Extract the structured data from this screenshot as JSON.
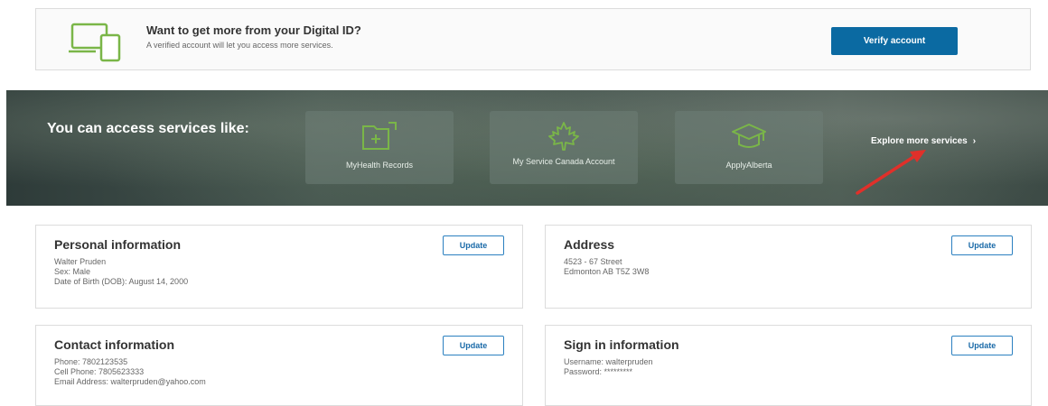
{
  "verify_banner": {
    "title": "Want to get more from your Digital ID?",
    "subtitle": "A verified account will let you access more services.",
    "button_label": "Verify account",
    "icon": "devices-icon",
    "accent_color": "#7ab648",
    "button_color": "#0b6aa2"
  },
  "services": {
    "title": "You can access services like:",
    "tiles": [
      {
        "label": "MyHealth Records",
        "icon": "folder-plus-icon"
      },
      {
        "label": "My Service Canada Account",
        "icon": "maple-leaf-icon"
      },
      {
        "label": "ApplyAlberta",
        "icon": "graduation-cap-icon"
      }
    ],
    "explore_label": "Explore more services",
    "explore_chevron": "›",
    "icon_color": "#7ab648"
  },
  "cards": {
    "personal": {
      "title": "Personal information",
      "lines": [
        "Walter Pruden",
        "Sex: Male",
        "Date of Birth (DOB): August 14, 2000"
      ],
      "button_label": "Update"
    },
    "address": {
      "title": "Address",
      "lines": [
        "4523 - 67 Street",
        "Edmonton AB T5Z 3W8"
      ],
      "button_label": "Update"
    },
    "contact": {
      "title": "Contact information",
      "lines": [
        "Phone: 7802123535",
        "Cell Phone: 7805623333",
        "Email Address: walterpruden@yahoo.com"
      ],
      "button_label": "Update"
    },
    "signin": {
      "title": "Sign in information",
      "lines": [
        "Username: walterpruden",
        "Password: *********"
      ],
      "button_label": "Update"
    }
  }
}
